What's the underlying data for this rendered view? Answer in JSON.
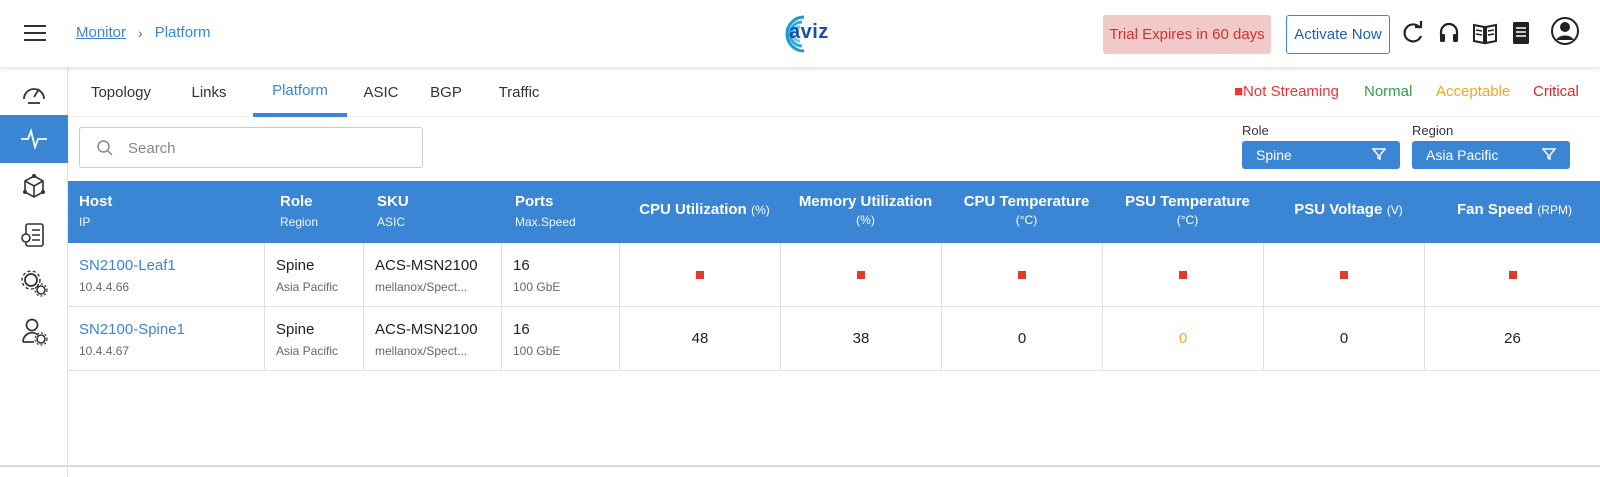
{
  "header": {
    "breadcrumb": {
      "root": "Monitor",
      "current": "Platform"
    },
    "logo_text": "aviz",
    "trial_text": "Trial Expires in 60 days",
    "activate_label": "Activate Now",
    "icons": [
      "refresh-icon",
      "headset-icon",
      "book-icon",
      "document-icon",
      "user-icon"
    ]
  },
  "sidebar": {
    "items": [
      {
        "name": "dashboard"
      },
      {
        "name": "monitor",
        "active": true
      },
      {
        "name": "topology"
      },
      {
        "name": "reports"
      },
      {
        "name": "settings"
      },
      {
        "name": "user-settings"
      }
    ]
  },
  "tabs": [
    {
      "label": "Topology"
    },
    {
      "label": "Links"
    },
    {
      "label": "Platform",
      "active": true
    },
    {
      "label": "ASIC"
    },
    {
      "label": "BGP"
    },
    {
      "label": "Traffic"
    }
  ],
  "legend": {
    "not_streaming": "■Not Streaming",
    "normal": "Normal",
    "acceptable": "Acceptable",
    "critical": "Critical",
    "colors": {
      "not_streaming": "#e33b2b",
      "normal": "#2ca14a",
      "acceptable": "#f5a623",
      "critical": "#e02424"
    }
  },
  "search": {
    "placeholder": "Search"
  },
  "filters": {
    "role": {
      "label": "Role",
      "value": "Spine"
    },
    "region": {
      "label": "Region",
      "value": "Asia Pacific"
    }
  },
  "table": {
    "columns": [
      {
        "main": "Host",
        "sub": "IP"
      },
      {
        "main": "Role",
        "sub": "Region"
      },
      {
        "main": "SKU",
        "sub": "ASIC"
      },
      {
        "main": "Ports",
        "sub": "Max.Speed"
      },
      {
        "main": "CPU Utilization",
        "unit": "(%)"
      },
      {
        "main": "Memory Utilization",
        "unit": "(%)"
      },
      {
        "main": "CPU Temperature",
        "unit": "(°C)"
      },
      {
        "main": "PSU Temperature",
        "unit": "(°C)"
      },
      {
        "main": "PSU Voltage",
        "unit": "(V)"
      },
      {
        "main": "Fan Speed",
        "unit": "(RPM)"
      }
    ],
    "rows": [
      {
        "host": "SN2100-Leaf1",
        "ip": "10.4.4.66",
        "role": "Spine",
        "region": "Asia Pacific",
        "sku": "ACS-MSN2100",
        "asic": "mellanox/Spect...",
        "ports": "16",
        "speed": "100 GbE",
        "metrics": [
          "not-streaming",
          "not-streaming",
          "not-streaming",
          "not-streaming",
          "not-streaming",
          "not-streaming"
        ]
      },
      {
        "host": "SN2100-Spine1",
        "ip": "10.4.4.67",
        "role": "Spine",
        "region": "Asia Pacific",
        "sku": "ACS-MSN2100",
        "asic": "mellanox/Spect...",
        "ports": "16",
        "speed": "100 GbE",
        "metrics": [
          "48",
          "38",
          "0",
          "0",
          "0",
          "26"
        ],
        "metric_status": [
          "normal",
          "normal",
          "normal",
          "acceptable",
          "normal",
          "normal"
        ]
      }
    ]
  }
}
